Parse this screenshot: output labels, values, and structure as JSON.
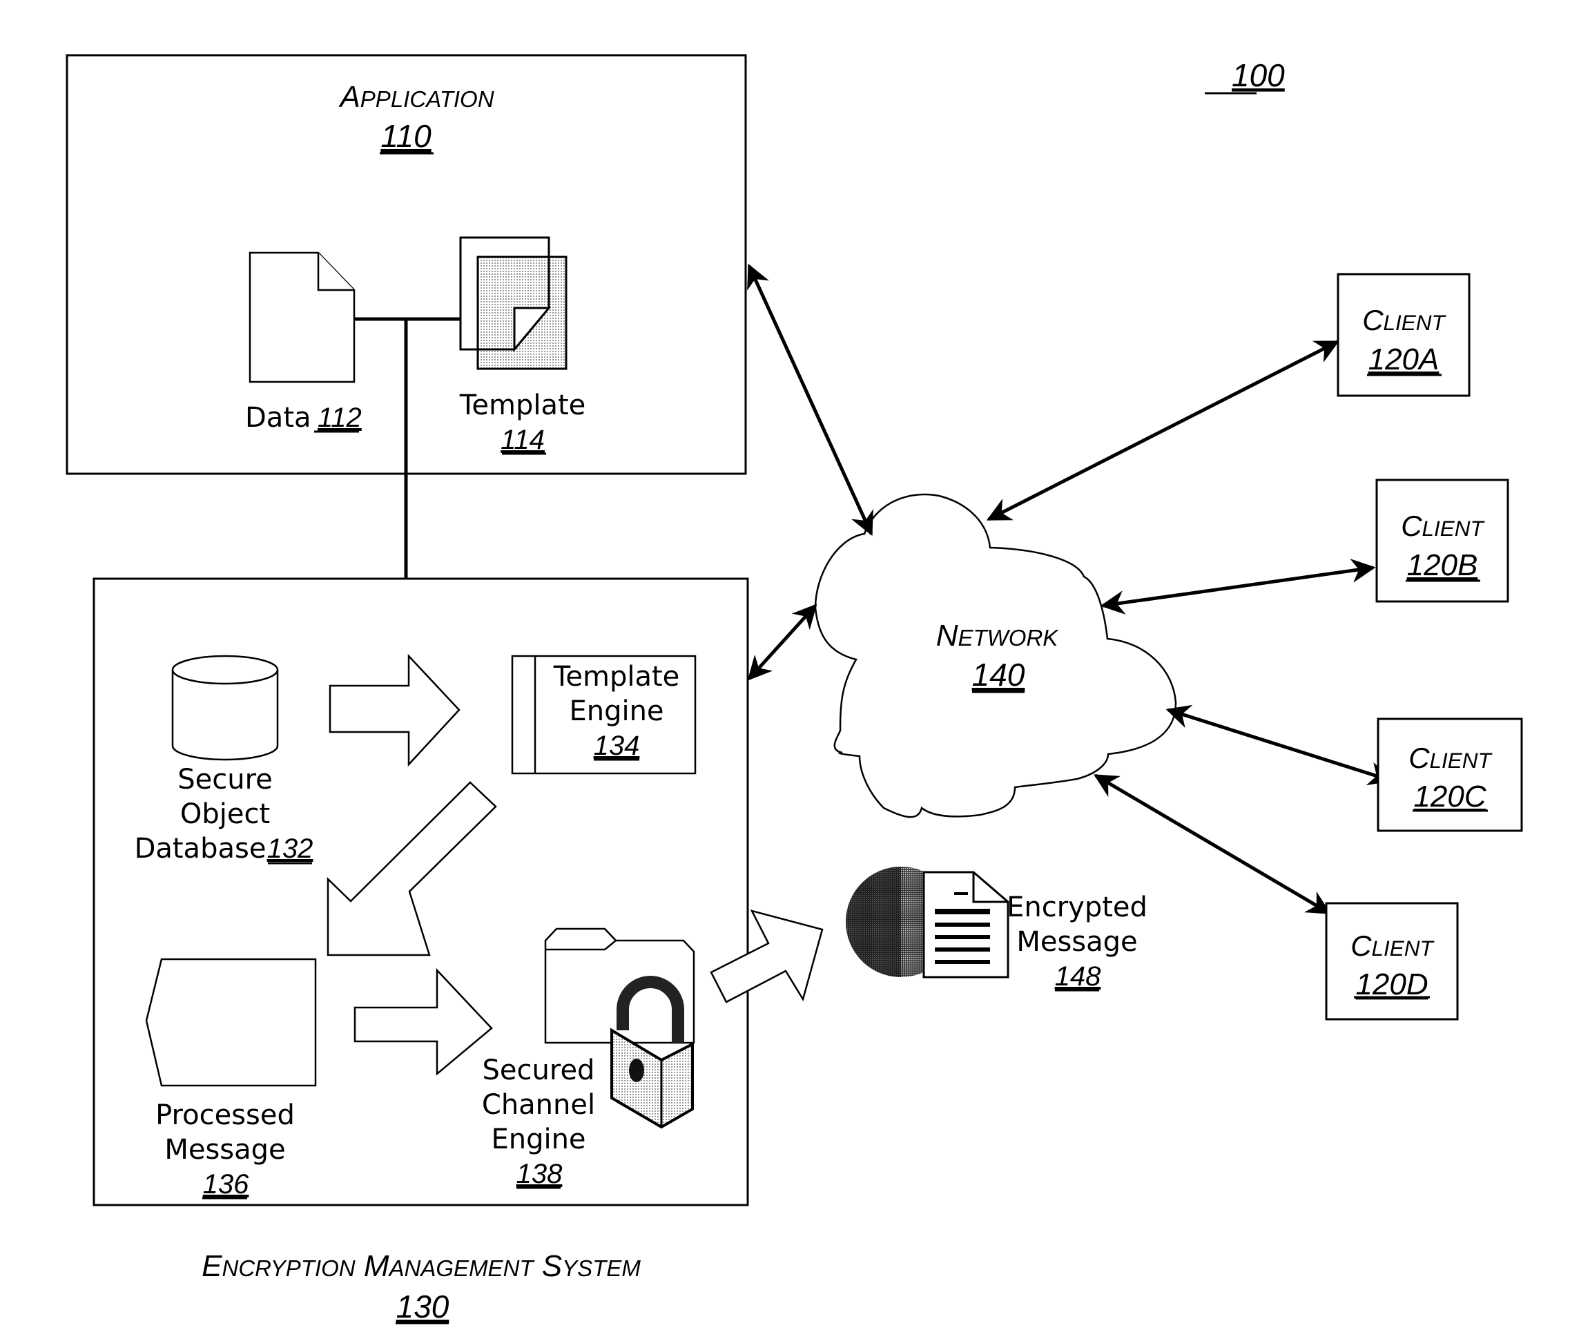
{
  "figure_number": "100",
  "application": {
    "title": "Application",
    "number": "110",
    "data": {
      "label": "Data",
      "number": "112"
    },
    "template": {
      "label": "Template",
      "number": "114"
    }
  },
  "encryption_management_system": {
    "title": "Encryption Management System",
    "number": "130",
    "secure_object_database": {
      "label_lines": [
        "Secure",
        "Object",
        "Database"
      ],
      "number": "132"
    },
    "template_engine": {
      "label_lines": [
        "Template",
        "Engine"
      ],
      "number": "134"
    },
    "processed_message": {
      "label_lines": [
        "Processed",
        "Message"
      ],
      "number": "136"
    },
    "secured_channel_engine": {
      "label_lines": [
        "Secured",
        "Channel",
        "Engine"
      ],
      "number": "138"
    }
  },
  "network": {
    "title": "Network",
    "number": "140"
  },
  "encrypted_message": {
    "label_lines": [
      "Encrypted",
      "Message"
    ],
    "number": "148"
  },
  "clients": [
    {
      "title": "Client",
      "number": "120A"
    },
    {
      "title": "Client",
      "number": "120B"
    },
    {
      "title": "Client",
      "number": "120C"
    },
    {
      "title": "Client",
      "number": "120D"
    }
  ],
  "icons": {
    "data": "document-icon",
    "template": "template-document-icon",
    "database": "database-cylinder-icon",
    "processed_message": "message-shape-icon",
    "secured_channel": "folder-lock-icon",
    "encrypted_message": "globe-document-icon"
  }
}
